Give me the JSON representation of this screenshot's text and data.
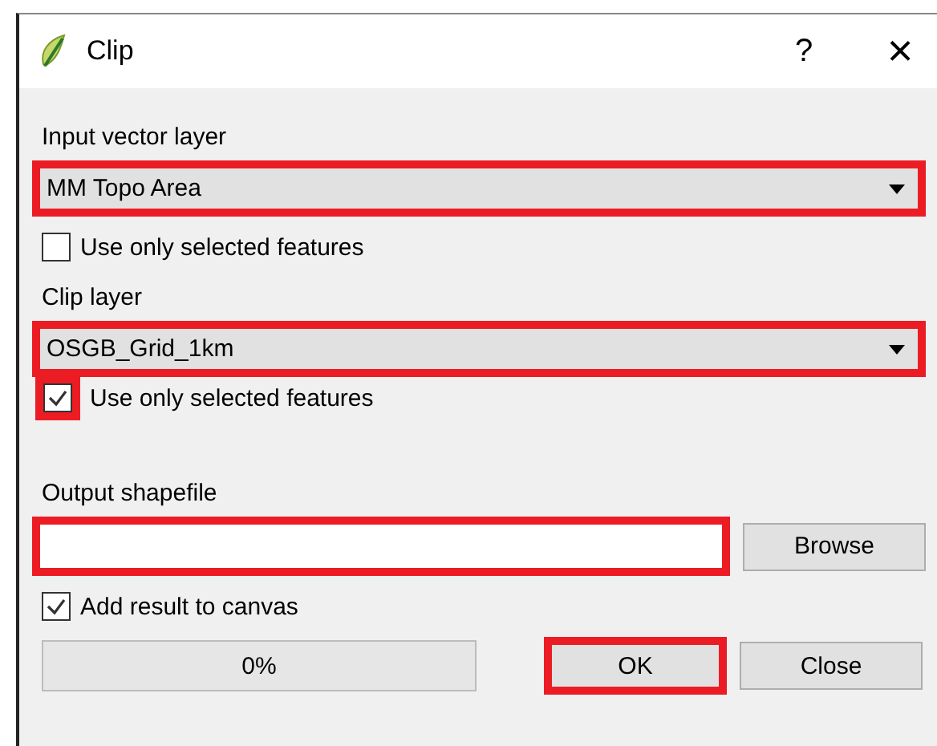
{
  "window": {
    "title": "Clip",
    "help": "?",
    "close": "×"
  },
  "input_vector_layer": {
    "label": "Input vector layer",
    "value": "MM Topo Area",
    "highlighted": true
  },
  "input_selected_only": {
    "label": "Use only selected features",
    "checked": false
  },
  "clip_layer": {
    "label": "Clip layer",
    "value": "OSGB_Grid_1km",
    "highlighted": true
  },
  "clip_selected_only": {
    "label": "Use only selected features",
    "checked": true,
    "highlighted": true
  },
  "output_shapefile": {
    "label": "Output shapefile",
    "highlighted": true,
    "browse": "Browse"
  },
  "add_to_canvas": {
    "label": "Add result to canvas",
    "checked": true
  },
  "progress": {
    "text": "0%",
    "level": 0
  },
  "buttons": [
    {
      "label": "OK",
      "highlighted": true
    },
    {
      "label": "Close",
      "highlighted": false
    }
  ]
}
